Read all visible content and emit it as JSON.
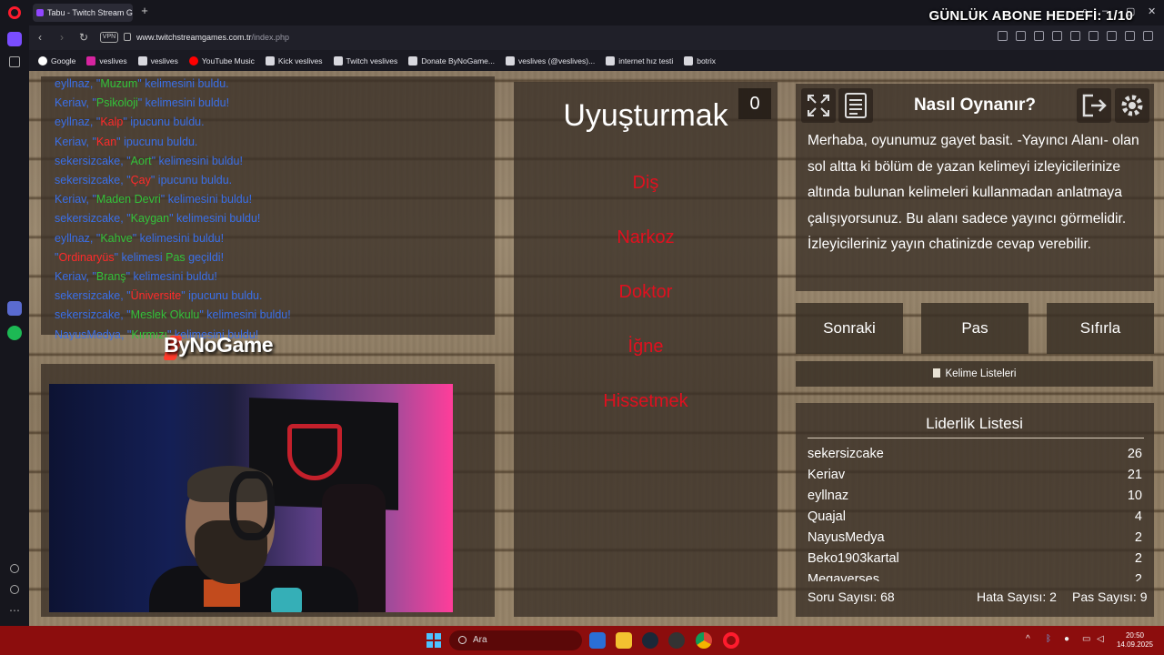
{
  "browser": {
    "tab_title": "Tabu - Twitch Stream Gam",
    "url_host": "www.twitchstreamgames.com.tr",
    "url_path": "/index.php",
    "vpn_label": "VPN",
    "bookmarks": [
      {
        "label": "Google",
        "icon": "google-icon"
      },
      {
        "label": "veslives",
        "icon": "instagram-icon"
      },
      {
        "label": "veslives",
        "icon": "bookmark-icon"
      },
      {
        "label": "YouTube Music",
        "icon": "youtube-music-icon"
      },
      {
        "label": "Kick veslives",
        "icon": "bookmark-icon"
      },
      {
        "label": "Twitch veslives",
        "icon": "bookmark-icon"
      },
      {
        "label": "Donate ByNoGame...",
        "icon": "bookmark-icon"
      },
      {
        "label": "veslives (@veslives)...",
        "icon": "bookmark-icon"
      },
      {
        "label": "internet hız testi",
        "icon": "bookmark-icon"
      },
      {
        "label": "botrix",
        "icon": "bookmark-icon"
      }
    ]
  },
  "overlay": {
    "goal_text": "GÜNLÜK ABONE HEDEFİ: 1/10",
    "brand": "ByNoGame"
  },
  "chat": [
    {
      "user": "eyllnaz,",
      "quote": "Muzum",
      "kind": "hl",
      "rest": " kelimesini buldu."
    },
    {
      "user": "Keriav,",
      "quote": "Psikoloji",
      "kind": "hl",
      "rest": " kelimesini buldu!"
    },
    {
      "user": "eyllnaz,",
      "quote": "Kalp",
      "kind": "rd",
      "rest": " ipucunu buldu."
    },
    {
      "user": "Keriav,",
      "quote": "Kan",
      "kind": "rd",
      "rest": " ipucunu buldu."
    },
    {
      "user": "sekersizcake,",
      "quote": "Aort",
      "kind": "hl",
      "rest": " kelimesini buldu!"
    },
    {
      "user": "sekersizcake,",
      "quote": "Çay",
      "kind": "rd",
      "rest": " ipucunu buldu."
    },
    {
      "user": "Keriav,",
      "quote": "Maden Devri",
      "kind": "hl",
      "rest": " kelimesini buldu!"
    },
    {
      "user": "sekersizcake,",
      "quote": "Kaygan",
      "kind": "hl",
      "rest": " kelimesini buldu!"
    },
    {
      "user": "eyllnaz,",
      "quote": "Kahve",
      "kind": "hl",
      "rest": " kelimesini buldu!"
    },
    {
      "user": "",
      "quote": "Ordinaryüs",
      "kind": "rd",
      "rest": " kelimesi Pas geçildi!",
      "pass": true
    },
    {
      "user": "Keriav,",
      "quote": "Branş",
      "kind": "hl",
      "rest": " kelimesini buldu!"
    },
    {
      "user": "sekersizcake,",
      "quote": "Üniversite",
      "kind": "rd",
      "rest": " ipucunu buldu."
    },
    {
      "user": "sekersizcake,",
      "quote": "Meslek Okulu",
      "kind": "hl",
      "rest": " kelimesini buldu!"
    },
    {
      "user": "NayusMedya,",
      "quote": "Kırmızı",
      "kind": "hl",
      "rest": " kelimesini buldu!"
    }
  ],
  "game": {
    "word": "Uyuşturmak",
    "score": "0",
    "taboo": [
      "Diş",
      "Narkoz",
      "Doktor",
      "İğne",
      "Hissetmek"
    ]
  },
  "help": {
    "title": "Nasıl Oynanır?",
    "body": "Merhaba, oyunumuz gayet basit. -Yayıncı Alanı- olan sol altta ki bölüm de yazan kelimeyi izleyicilerinize altında bulunan kelimeleri kullanmadan anlatmaya çalışıyorsunuz. Bu alanı sadece yayıncı görmelidir. İzleyicileriniz yayın chatinizde cevap verebilir."
  },
  "controls": {
    "next": "Sonraki",
    "pass": "Pas",
    "reset": "Sıfırla",
    "word_lists": "Kelime Listeleri"
  },
  "leaderboard": {
    "title": "Liderlik Listesi",
    "rows": [
      {
        "name": "sekersizcake",
        "score": "26"
      },
      {
        "name": "Keriav",
        "score": "21"
      },
      {
        "name": "eyllnaz",
        "score": "10"
      },
      {
        "name": "Quajal",
        "score": "4"
      },
      {
        "name": "NayusMedya",
        "score": "2"
      },
      {
        "name": "Beko1903kartal",
        "score": "2"
      },
      {
        "name": "Megaverses",
        "score": "2"
      }
    ]
  },
  "stats": {
    "questions": "Soru Sayısı: 68",
    "errors": "Hata Sayısı: 2",
    "passes": "Pas Sayısı: 9"
  },
  "taskbar": {
    "search_placeholder": "Ara",
    "time": "20:50",
    "date": "14.09.2025"
  },
  "colors": {
    "chat_user": "#3a6fe8",
    "chat_found": "#33c23a",
    "chat_hint": "#ff2a2a",
    "taboo": "#e0101f",
    "taskbar": "#8c0d0d"
  }
}
